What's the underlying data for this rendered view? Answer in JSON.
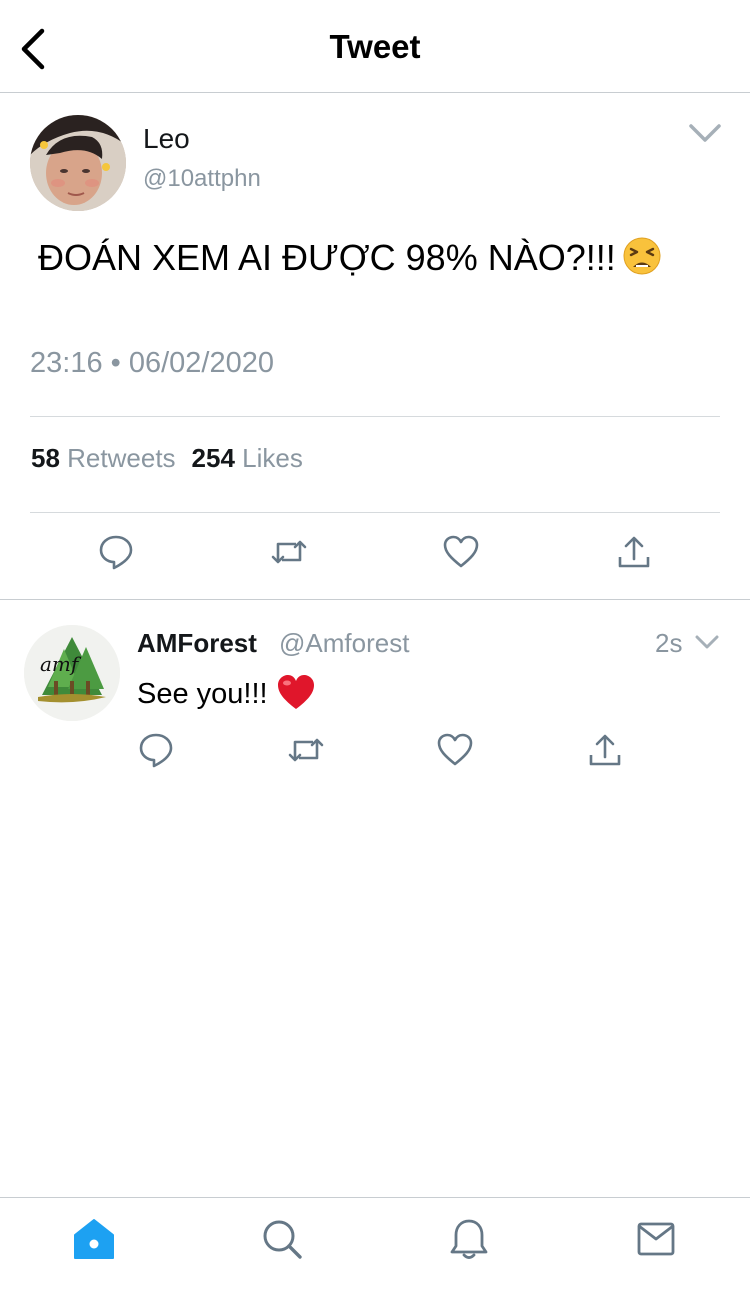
{
  "header": {
    "title": "Tweet"
  },
  "main_tweet": {
    "author_name": "Leo",
    "author_handle": "@10attphn",
    "text": "ĐOÁN XEM AI ĐƯỢC 98% NÀO?!!!",
    "timestamp": "23:16 • 06/02/2020",
    "retweets_count": "58",
    "retweets_label": "Retweets",
    "likes_count": "254",
    "likes_label": "Likes"
  },
  "reply": {
    "author_name": "AMForest",
    "author_handle": "@Amforest",
    "time": "2s",
    "text": "See you!!!",
    "avatar_text": "amf"
  },
  "colors": {
    "accent": "#1da1f2",
    "muted": "#8a96a0",
    "icon": "#657786",
    "border": "#c8cdd1"
  },
  "icons": {
    "back": "chevron-left-icon",
    "menu": "chevron-down-icon",
    "reply": "reply-icon",
    "retweet": "retweet-icon",
    "like": "heart-outline-icon",
    "share": "share-icon",
    "tabs": [
      "home-icon",
      "search-icon",
      "notifications-icon",
      "messages-icon"
    ]
  }
}
